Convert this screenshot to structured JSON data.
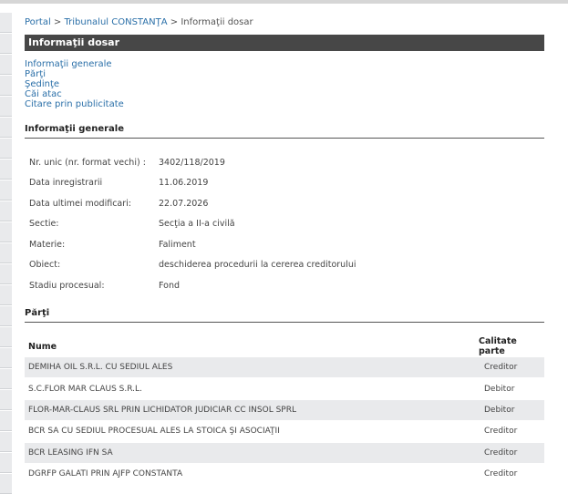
{
  "breadcrumb": {
    "portal": "Portal",
    "sep1": ">",
    "court": "Tribunalul CONSTANŢA",
    "sep2": ">",
    "current": "Informaţii dosar"
  },
  "title": "Informaţii dosar",
  "nav": [
    "Informaţii generale",
    "Părţi",
    "Şedinţe",
    "Căi atac",
    "Citare prin publicitate"
  ],
  "info": {
    "heading": "Informaţii generale",
    "rows": [
      {
        "label": "Nr. unic (nr. format vechi) :",
        "value": "3402/118/2019"
      },
      {
        "label": "Data inregistrarii",
        "value": "11.06.2019"
      },
      {
        "label": "Data ultimei modificari:",
        "value": "22.07.2026"
      },
      {
        "label": "Sectie:",
        "value": "Secţia a II-a civilă"
      },
      {
        "label": "Materie:",
        "value": "Faliment"
      },
      {
        "label": "Obiect:",
        "value": "deschiderea procedurii la cererea creditorului"
      },
      {
        "label": "Stadiu procesual:",
        "value": "Fond"
      }
    ]
  },
  "parti": {
    "heading": "Părţi",
    "columns": [
      "Nume",
      "Calitate parte"
    ],
    "rows": [
      {
        "nume": "DEMIHA OIL S.R.L. CU SEDIUL ALES",
        "calitate": "Creditor"
      },
      {
        "nume": "S.C.FLOR MAR CLAUS S.R.L.",
        "calitate": "Debitor"
      },
      {
        "nume": "FLOR-MAR-CLAUS SRL PRIN LICHIDATOR JUDICIAR CC INSOL SPRL",
        "calitate": "Debitor"
      },
      {
        "nume": "BCR SA CU SEDIUL PROCESUAL ALES LA STOICA ŞI ASOCIAŢII",
        "calitate": "Creditor"
      },
      {
        "nume": "BCR LEASING IFN SA",
        "calitate": "Creditor"
      },
      {
        "nume": "DGRFP GALATI PRIN AJFP CONSTANTA",
        "calitate": "Creditor"
      }
    ]
  }
}
